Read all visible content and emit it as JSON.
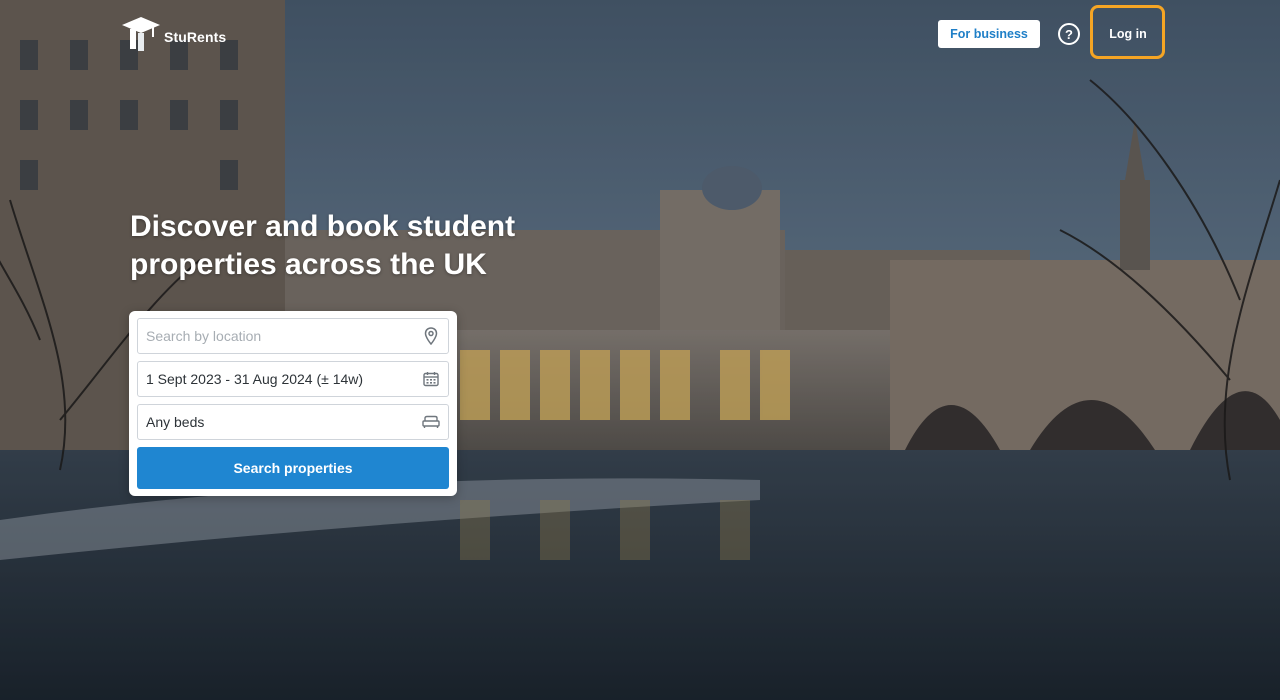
{
  "brand": {
    "name": "StuRents",
    "accent": "#1f86d1",
    "highlight": "#f5a524"
  },
  "header": {
    "for_business_label": "For business",
    "help_icon": "question-circle-icon",
    "login_label": "Log in"
  },
  "hero": {
    "headline_line1": "Discover and book student",
    "headline_line2": "properties across the UK"
  },
  "search": {
    "location_placeholder": "Search by location",
    "location_icon": "map-pin-icon",
    "dates_value": "1 Sept 2023 - 31 Aug 2024 (± 14w)",
    "dates_icon": "calendar-icon",
    "beds_value": "Any beds",
    "beds_icon": "bed-icon",
    "submit_label": "Search properties"
  }
}
